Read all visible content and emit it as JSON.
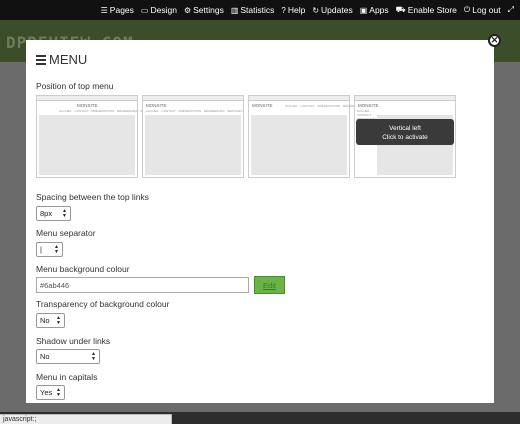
{
  "topbar": {
    "items": [
      {
        "label": "Pages",
        "icon": "list-icon"
      },
      {
        "label": "Design",
        "icon": "monitor-icon"
      },
      {
        "label": "Settings",
        "icon": "gear-icon"
      },
      {
        "label": "Statistics",
        "icon": "bar-chart-icon"
      },
      {
        "label": "Help",
        "icon": "question-icon"
      },
      {
        "label": "Updates",
        "icon": "refresh-icon"
      },
      {
        "label": "Apps",
        "icon": "briefcase-icon"
      },
      {
        "label": "Enable Store",
        "icon": "cart-icon"
      },
      {
        "label": "Log out",
        "icon": "power-icon"
      }
    ]
  },
  "background": {
    "logo": "DPREVIEW.COM"
  },
  "modal": {
    "title": "MENU",
    "position_label": "Position of top menu",
    "previews": [
      {
        "logo": "MONSITE",
        "menu": "ACCUEIL · CONTACT · PRÉSENTATION · RÉFÉRENCES · SERVICES"
      },
      {
        "logo": "MONSITE",
        "menu": "ACCUEIL · CONTACT · PRÉSENTATION · RÉFÉRENCES · SERVICES"
      },
      {
        "logo": "MONSITE",
        "menu": "ACCUEIL · CONTACT · PRÉSENTATION · RÉFÉRENCES · SERVICES"
      },
      {
        "logo": "MONSITE",
        "menu": "ACCUEIL · CONTACT · PRÉSENTATION · RÉFÉRENCES · SERVICES"
      }
    ],
    "tooltip": {
      "title": "Vertical left",
      "subtitle": "Click to activate"
    },
    "spacing": {
      "label": "Spacing between the top links",
      "value": "8px"
    },
    "separator": {
      "label": "Menu separator",
      "value": "|"
    },
    "bg_colour": {
      "label": "Menu background colour",
      "value": "#6ab446",
      "edit_label": "Edit",
      "swatch": "#6ab446"
    },
    "transparency": {
      "label": "Transparency of background colour",
      "value": "No"
    },
    "shadow": {
      "label": "Shadow under links",
      "value": "No"
    },
    "capitals": {
      "label": "Menu in capitals",
      "value": "Yes"
    }
  },
  "status": {
    "text": "javascript:;"
  }
}
